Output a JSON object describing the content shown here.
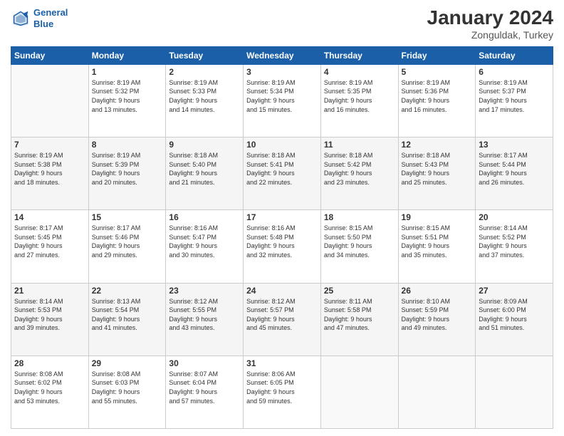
{
  "header": {
    "logo_line1": "General",
    "logo_line2": "Blue",
    "month_title": "January 2024",
    "subtitle": "Zonguldak, Turkey"
  },
  "days_of_week": [
    "Sunday",
    "Monday",
    "Tuesday",
    "Wednesday",
    "Thursday",
    "Friday",
    "Saturday"
  ],
  "weeks": [
    [
      {
        "day": "",
        "sunrise": "",
        "sunset": "",
        "daylight": ""
      },
      {
        "day": "1",
        "sunrise": "Sunrise: 8:19 AM",
        "sunset": "Sunset: 5:32 PM",
        "daylight": "Daylight: 9 hours and 13 minutes."
      },
      {
        "day": "2",
        "sunrise": "Sunrise: 8:19 AM",
        "sunset": "Sunset: 5:33 PM",
        "daylight": "Daylight: 9 hours and 14 minutes."
      },
      {
        "day": "3",
        "sunrise": "Sunrise: 8:19 AM",
        "sunset": "Sunset: 5:34 PM",
        "daylight": "Daylight: 9 hours and 15 minutes."
      },
      {
        "day": "4",
        "sunrise": "Sunrise: 8:19 AM",
        "sunset": "Sunset: 5:35 PM",
        "daylight": "Daylight: 9 hours and 16 minutes."
      },
      {
        "day": "5",
        "sunrise": "Sunrise: 8:19 AM",
        "sunset": "Sunset: 5:36 PM",
        "daylight": "Daylight: 9 hours and 16 minutes."
      },
      {
        "day": "6",
        "sunrise": "Sunrise: 8:19 AM",
        "sunset": "Sunset: 5:37 PM",
        "daylight": "Daylight: 9 hours and 17 minutes."
      }
    ],
    [
      {
        "day": "7",
        "sunrise": "Sunrise: 8:19 AM",
        "sunset": "Sunset: 5:38 PM",
        "daylight": "Daylight: 9 hours and 18 minutes."
      },
      {
        "day": "8",
        "sunrise": "Sunrise: 8:19 AM",
        "sunset": "Sunset: 5:39 PM",
        "daylight": "Daylight: 9 hours and 20 minutes."
      },
      {
        "day": "9",
        "sunrise": "Sunrise: 8:18 AM",
        "sunset": "Sunset: 5:40 PM",
        "daylight": "Daylight: 9 hours and 21 minutes."
      },
      {
        "day": "10",
        "sunrise": "Sunrise: 8:18 AM",
        "sunset": "Sunset: 5:41 PM",
        "daylight": "Daylight: 9 hours and 22 minutes."
      },
      {
        "day": "11",
        "sunrise": "Sunrise: 8:18 AM",
        "sunset": "Sunset: 5:42 PM",
        "daylight": "Daylight: 9 hours and 23 minutes."
      },
      {
        "day": "12",
        "sunrise": "Sunrise: 8:18 AM",
        "sunset": "Sunset: 5:43 PM",
        "daylight": "Daylight: 9 hours and 25 minutes."
      },
      {
        "day": "13",
        "sunrise": "Sunrise: 8:17 AM",
        "sunset": "Sunset: 5:44 PM",
        "daylight": "Daylight: 9 hours and 26 minutes."
      }
    ],
    [
      {
        "day": "14",
        "sunrise": "Sunrise: 8:17 AM",
        "sunset": "Sunset: 5:45 PM",
        "daylight": "Daylight: 9 hours and 27 minutes."
      },
      {
        "day": "15",
        "sunrise": "Sunrise: 8:17 AM",
        "sunset": "Sunset: 5:46 PM",
        "daylight": "Daylight: 9 hours and 29 minutes."
      },
      {
        "day": "16",
        "sunrise": "Sunrise: 8:16 AM",
        "sunset": "Sunset: 5:47 PM",
        "daylight": "Daylight: 9 hours and 30 minutes."
      },
      {
        "day": "17",
        "sunrise": "Sunrise: 8:16 AM",
        "sunset": "Sunset: 5:48 PM",
        "daylight": "Daylight: 9 hours and 32 minutes."
      },
      {
        "day": "18",
        "sunrise": "Sunrise: 8:15 AM",
        "sunset": "Sunset: 5:50 PM",
        "daylight": "Daylight: 9 hours and 34 minutes."
      },
      {
        "day": "19",
        "sunrise": "Sunrise: 8:15 AM",
        "sunset": "Sunset: 5:51 PM",
        "daylight": "Daylight: 9 hours and 35 minutes."
      },
      {
        "day": "20",
        "sunrise": "Sunrise: 8:14 AM",
        "sunset": "Sunset: 5:52 PM",
        "daylight": "Daylight: 9 hours and 37 minutes."
      }
    ],
    [
      {
        "day": "21",
        "sunrise": "Sunrise: 8:14 AM",
        "sunset": "Sunset: 5:53 PM",
        "daylight": "Daylight: 9 hours and 39 minutes."
      },
      {
        "day": "22",
        "sunrise": "Sunrise: 8:13 AM",
        "sunset": "Sunset: 5:54 PM",
        "daylight": "Daylight: 9 hours and 41 minutes."
      },
      {
        "day": "23",
        "sunrise": "Sunrise: 8:12 AM",
        "sunset": "Sunset: 5:55 PM",
        "daylight": "Daylight: 9 hours and 43 minutes."
      },
      {
        "day": "24",
        "sunrise": "Sunrise: 8:12 AM",
        "sunset": "Sunset: 5:57 PM",
        "daylight": "Daylight: 9 hours and 45 minutes."
      },
      {
        "day": "25",
        "sunrise": "Sunrise: 8:11 AM",
        "sunset": "Sunset: 5:58 PM",
        "daylight": "Daylight: 9 hours and 47 minutes."
      },
      {
        "day": "26",
        "sunrise": "Sunrise: 8:10 AM",
        "sunset": "Sunset: 5:59 PM",
        "daylight": "Daylight: 9 hours and 49 minutes."
      },
      {
        "day": "27",
        "sunrise": "Sunrise: 8:09 AM",
        "sunset": "Sunset: 6:00 PM",
        "daylight": "Daylight: 9 hours and 51 minutes."
      }
    ],
    [
      {
        "day": "28",
        "sunrise": "Sunrise: 8:08 AM",
        "sunset": "Sunset: 6:02 PM",
        "daylight": "Daylight: 9 hours and 53 minutes."
      },
      {
        "day": "29",
        "sunrise": "Sunrise: 8:08 AM",
        "sunset": "Sunset: 6:03 PM",
        "daylight": "Daylight: 9 hours and 55 minutes."
      },
      {
        "day": "30",
        "sunrise": "Sunrise: 8:07 AM",
        "sunset": "Sunset: 6:04 PM",
        "daylight": "Daylight: 9 hours and 57 minutes."
      },
      {
        "day": "31",
        "sunrise": "Sunrise: 8:06 AM",
        "sunset": "Sunset: 6:05 PM",
        "daylight": "Daylight: 9 hours and 59 minutes."
      },
      {
        "day": "",
        "sunrise": "",
        "sunset": "",
        "daylight": ""
      },
      {
        "day": "",
        "sunrise": "",
        "sunset": "",
        "daylight": ""
      },
      {
        "day": "",
        "sunrise": "",
        "sunset": "",
        "daylight": ""
      }
    ]
  ]
}
